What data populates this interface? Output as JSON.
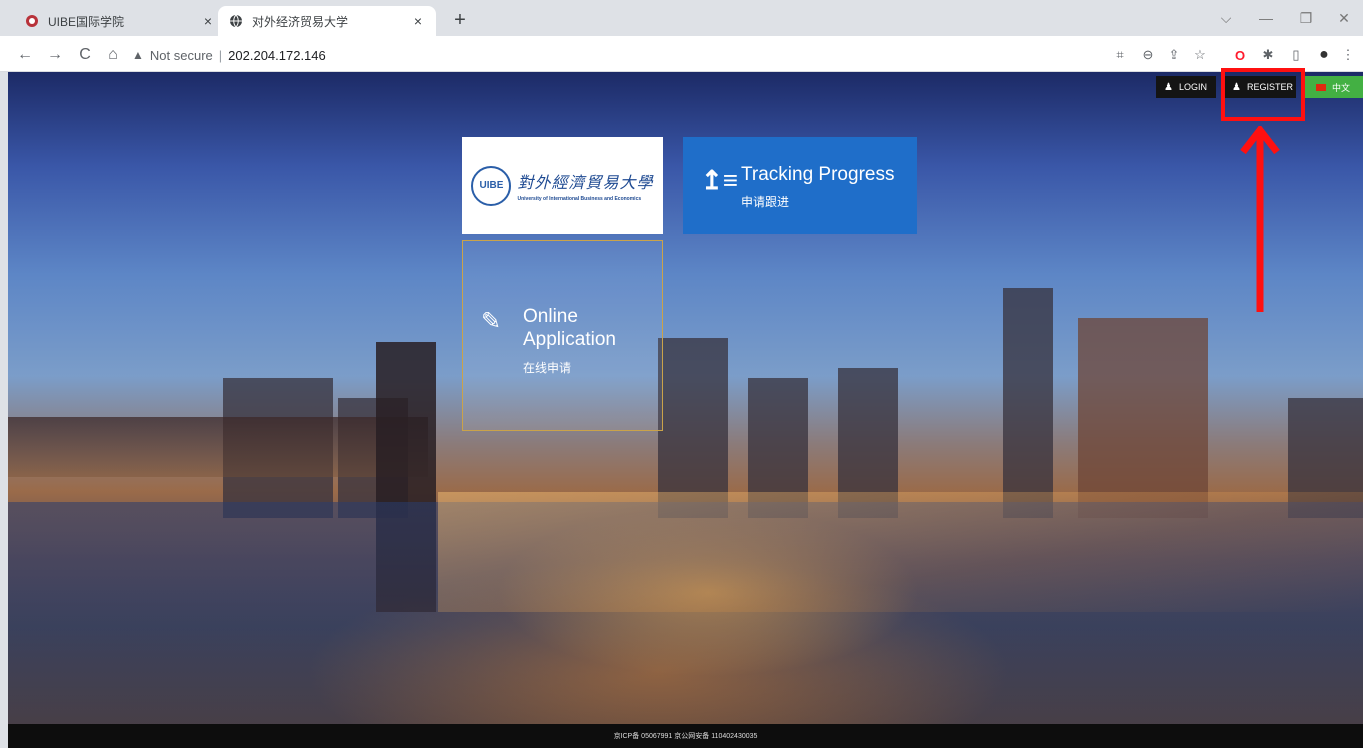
{
  "browser": {
    "tabs": [
      {
        "title": "UIBE国际学院",
        "close": "×",
        "active": false,
        "icon": "uibe-logo-icon"
      },
      {
        "title": "对外经济贸易大学",
        "close": "×",
        "active": true,
        "icon": "globe-icon"
      }
    ],
    "new_tab": "+",
    "window_controls": {
      "dropdown": "⌵",
      "minimize": "—",
      "restore": "❐",
      "close": "✕"
    },
    "nav": {
      "back": "←",
      "forward": "→",
      "reload": "C",
      "home": "⌂"
    },
    "address": {
      "security_icon": "▲",
      "security_label": "Not secure",
      "separator": "|",
      "url": "202.204.172.146"
    },
    "toolbar_icons": {
      "translate": "⌗",
      "zoom": "⊖",
      "share": "⇪",
      "bookmark": "☆",
      "opera": "O",
      "extensions": "✱",
      "sidepanel": "▯",
      "profile": "●",
      "menu": "⋮"
    }
  },
  "header": {
    "login_label": "LOGIN",
    "register_label": "REGISTER",
    "lang_label": "中文",
    "user_icon": "♟"
  },
  "tiles": {
    "logo": {
      "emblem": "UIBE",
      "cn_name": "對外經濟貿易大學",
      "en_name": "University of International Business and Economics"
    },
    "tracking": {
      "title": "Tracking Progress",
      "subtitle": "申请跟进",
      "icon": "↥≡"
    },
    "online": {
      "title_line1": "Online",
      "title_line2": "Application",
      "subtitle": "在线申请",
      "icon": "✎"
    }
  },
  "footer": {
    "text": "京ICP备 05067991 京公网安备 110402430035"
  },
  "colors": {
    "tracking_tile": "#1f6ec9",
    "lang_button": "#43b043",
    "annotation": "#ff1010",
    "online_border": "#caa34a"
  }
}
